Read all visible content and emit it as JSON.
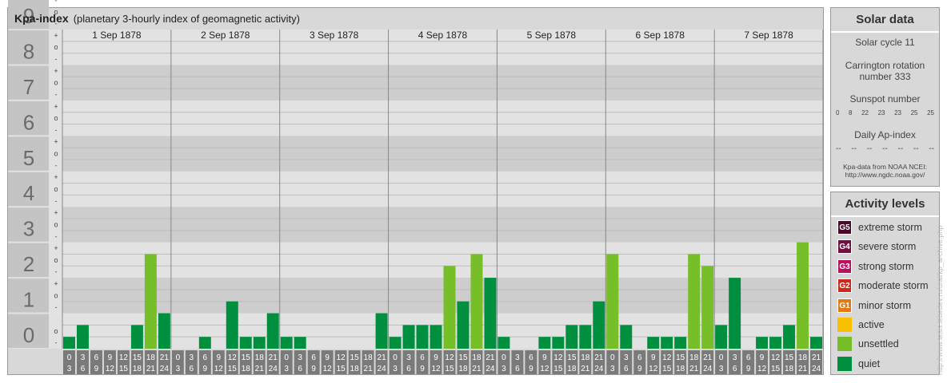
{
  "title": "Kpa-index",
  "subtitle": "(planetary 3-hourly index of geomagnetic activity)",
  "chart_data": {
    "type": "bar",
    "title": "Kpa-index",
    "subtitle": "(planetary 3-hourly index of geomagnetic activity)",
    "ylim": [
      0,
      9
    ],
    "y_ticks": [
      "0",
      "1",
      "2",
      "3",
      "4",
      "5",
      "6",
      "7",
      "8",
      "9"
    ],
    "minor_ticks": [
      "+",
      "o",
      "-"
    ],
    "days": [
      "1 Sep 1878",
      "2 Sep 1878",
      "3 Sep 1878",
      "4 Sep 1878",
      "5 Sep 1878",
      "6 Sep 1878",
      "7 Sep 1878"
    ],
    "interval_labels": [
      [
        "0",
        "3"
      ],
      [
        "3",
        "6"
      ],
      [
        "6",
        "9"
      ],
      [
        "9",
        "12"
      ],
      [
        "12",
        "15"
      ],
      [
        "15",
        "18"
      ],
      [
        "18",
        "21"
      ],
      [
        "21",
        "24"
      ]
    ],
    "values": [
      [
        0.333,
        0.667,
        0,
        0,
        0,
        0.667,
        2.667,
        1.0
      ],
      [
        0,
        0,
        0.333,
        0,
        1.333,
        0.333,
        0.333,
        1.0
      ],
      [
        0.333,
        0.333,
        0,
        0,
        0,
        0,
        0,
        1.0
      ],
      [
        0.333,
        0.667,
        0.667,
        0.667,
        2.333,
        1.333,
        2.667,
        2.0
      ],
      [
        0.333,
        0,
        0,
        0.333,
        0.333,
        0.667,
        0.667,
        1.333
      ],
      [
        2.667,
        0.667,
        0,
        0.333,
        0.333,
        0.333,
        2.667,
        2.333
      ],
      [
        0.667,
        2.0,
        0,
        0.333,
        0.333,
        0.667,
        3.0,
        0.333
      ]
    ],
    "levels": [
      {
        "name": "quiet",
        "max": 2,
        "color": "#008f3e"
      },
      {
        "name": "unsettled",
        "max": 3.99,
        "color": "#76bf29"
      }
    ]
  },
  "solar": {
    "header": "Solar data",
    "cycle": "Solar cycle 11",
    "carrington_line1": "Carrington rotation",
    "carrington_line2": "number 333",
    "sunspot_label": "Sunspot number",
    "sunspot_values": [
      "0",
      "8",
      "22",
      "23",
      "23",
      "25",
      "25"
    ],
    "ap_label": "Daily Ap-index",
    "ap_values": [
      "--",
      "--",
      "--",
      "--",
      "--",
      "--",
      "--"
    ],
    "source_line1": "Kpa-data from NOAA NCEI:",
    "source_line2": "http://www.ngdc.noaa.gov/"
  },
  "activity": {
    "header": "Activity levels",
    "items": [
      {
        "code": "G5",
        "label": "extreme storm",
        "color": "#4a0a2c"
      },
      {
        "code": "G4",
        "label": "severe storm",
        "color": "#6e1040"
      },
      {
        "code": "G3",
        "label": "strong storm",
        "color": "#b8105c"
      },
      {
        "code": "G2",
        "label": "moderate storm",
        "color": "#cc2a18"
      },
      {
        "code": "G1",
        "label": "minor storm",
        "color": "#e07a12"
      },
      {
        "code": "",
        "label": "active",
        "color": "#f8c000"
      },
      {
        "code": "",
        "label": "unsettled",
        "color": "#76bf29"
      },
      {
        "code": "",
        "label": "quiet",
        "color": "#008f3e"
      }
    ]
  },
  "credit": "http://www.tesis.lebedev.ru/ural/kp_archive.php"
}
